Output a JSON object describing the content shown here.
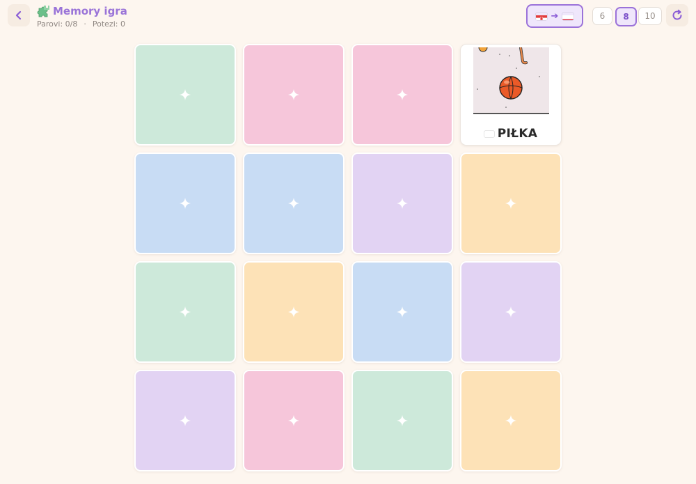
{
  "header": {
    "title": "Memory igra",
    "title_icon": "puzzle-piece-icon",
    "stats": {
      "pairs": "Parovi: 0/8",
      "separator": "·",
      "moves": "Potezi: 0"
    },
    "back_icon": "chevron-left-icon",
    "refresh_icon": "refresh-icon",
    "language": {
      "from_flag": "croatia-flag-icon",
      "arrow": "➔",
      "to_flag": "poland-flag-icon"
    },
    "sizes": [
      {
        "label": "6",
        "active": false
      },
      {
        "label": "8",
        "active": true
      },
      {
        "label": "10",
        "active": false
      }
    ]
  },
  "colors": {
    "accent": "#9b72d9",
    "background": "#fdf6ef",
    "card_green": "#cde9da",
    "card_pink": "#f6c6da",
    "card_blue": "#c8dcf4",
    "card_purple": "#e2d3f3",
    "card_peach": "#fde2b7"
  },
  "board": {
    "cards": [
      {
        "state": "hidden",
        "color": "green"
      },
      {
        "state": "hidden",
        "color": "pink"
      },
      {
        "state": "hidden",
        "color": "pink"
      },
      {
        "state": "revealed",
        "word": "PIŁKA",
        "flag": "poland-flag-icon",
        "image": "ball-illustration"
      },
      {
        "state": "hidden",
        "color": "blue"
      },
      {
        "state": "hidden",
        "color": "blue"
      },
      {
        "state": "hidden",
        "color": "purple"
      },
      {
        "state": "hidden",
        "color": "peach"
      },
      {
        "state": "hidden",
        "color": "green"
      },
      {
        "state": "hidden",
        "color": "peach"
      },
      {
        "state": "hidden",
        "color": "blue"
      },
      {
        "state": "hidden",
        "color": "purple"
      },
      {
        "state": "hidden",
        "color": "purple"
      },
      {
        "state": "hidden",
        "color": "pink"
      },
      {
        "state": "hidden",
        "color": "green"
      },
      {
        "state": "hidden",
        "color": "peach"
      }
    ]
  }
}
